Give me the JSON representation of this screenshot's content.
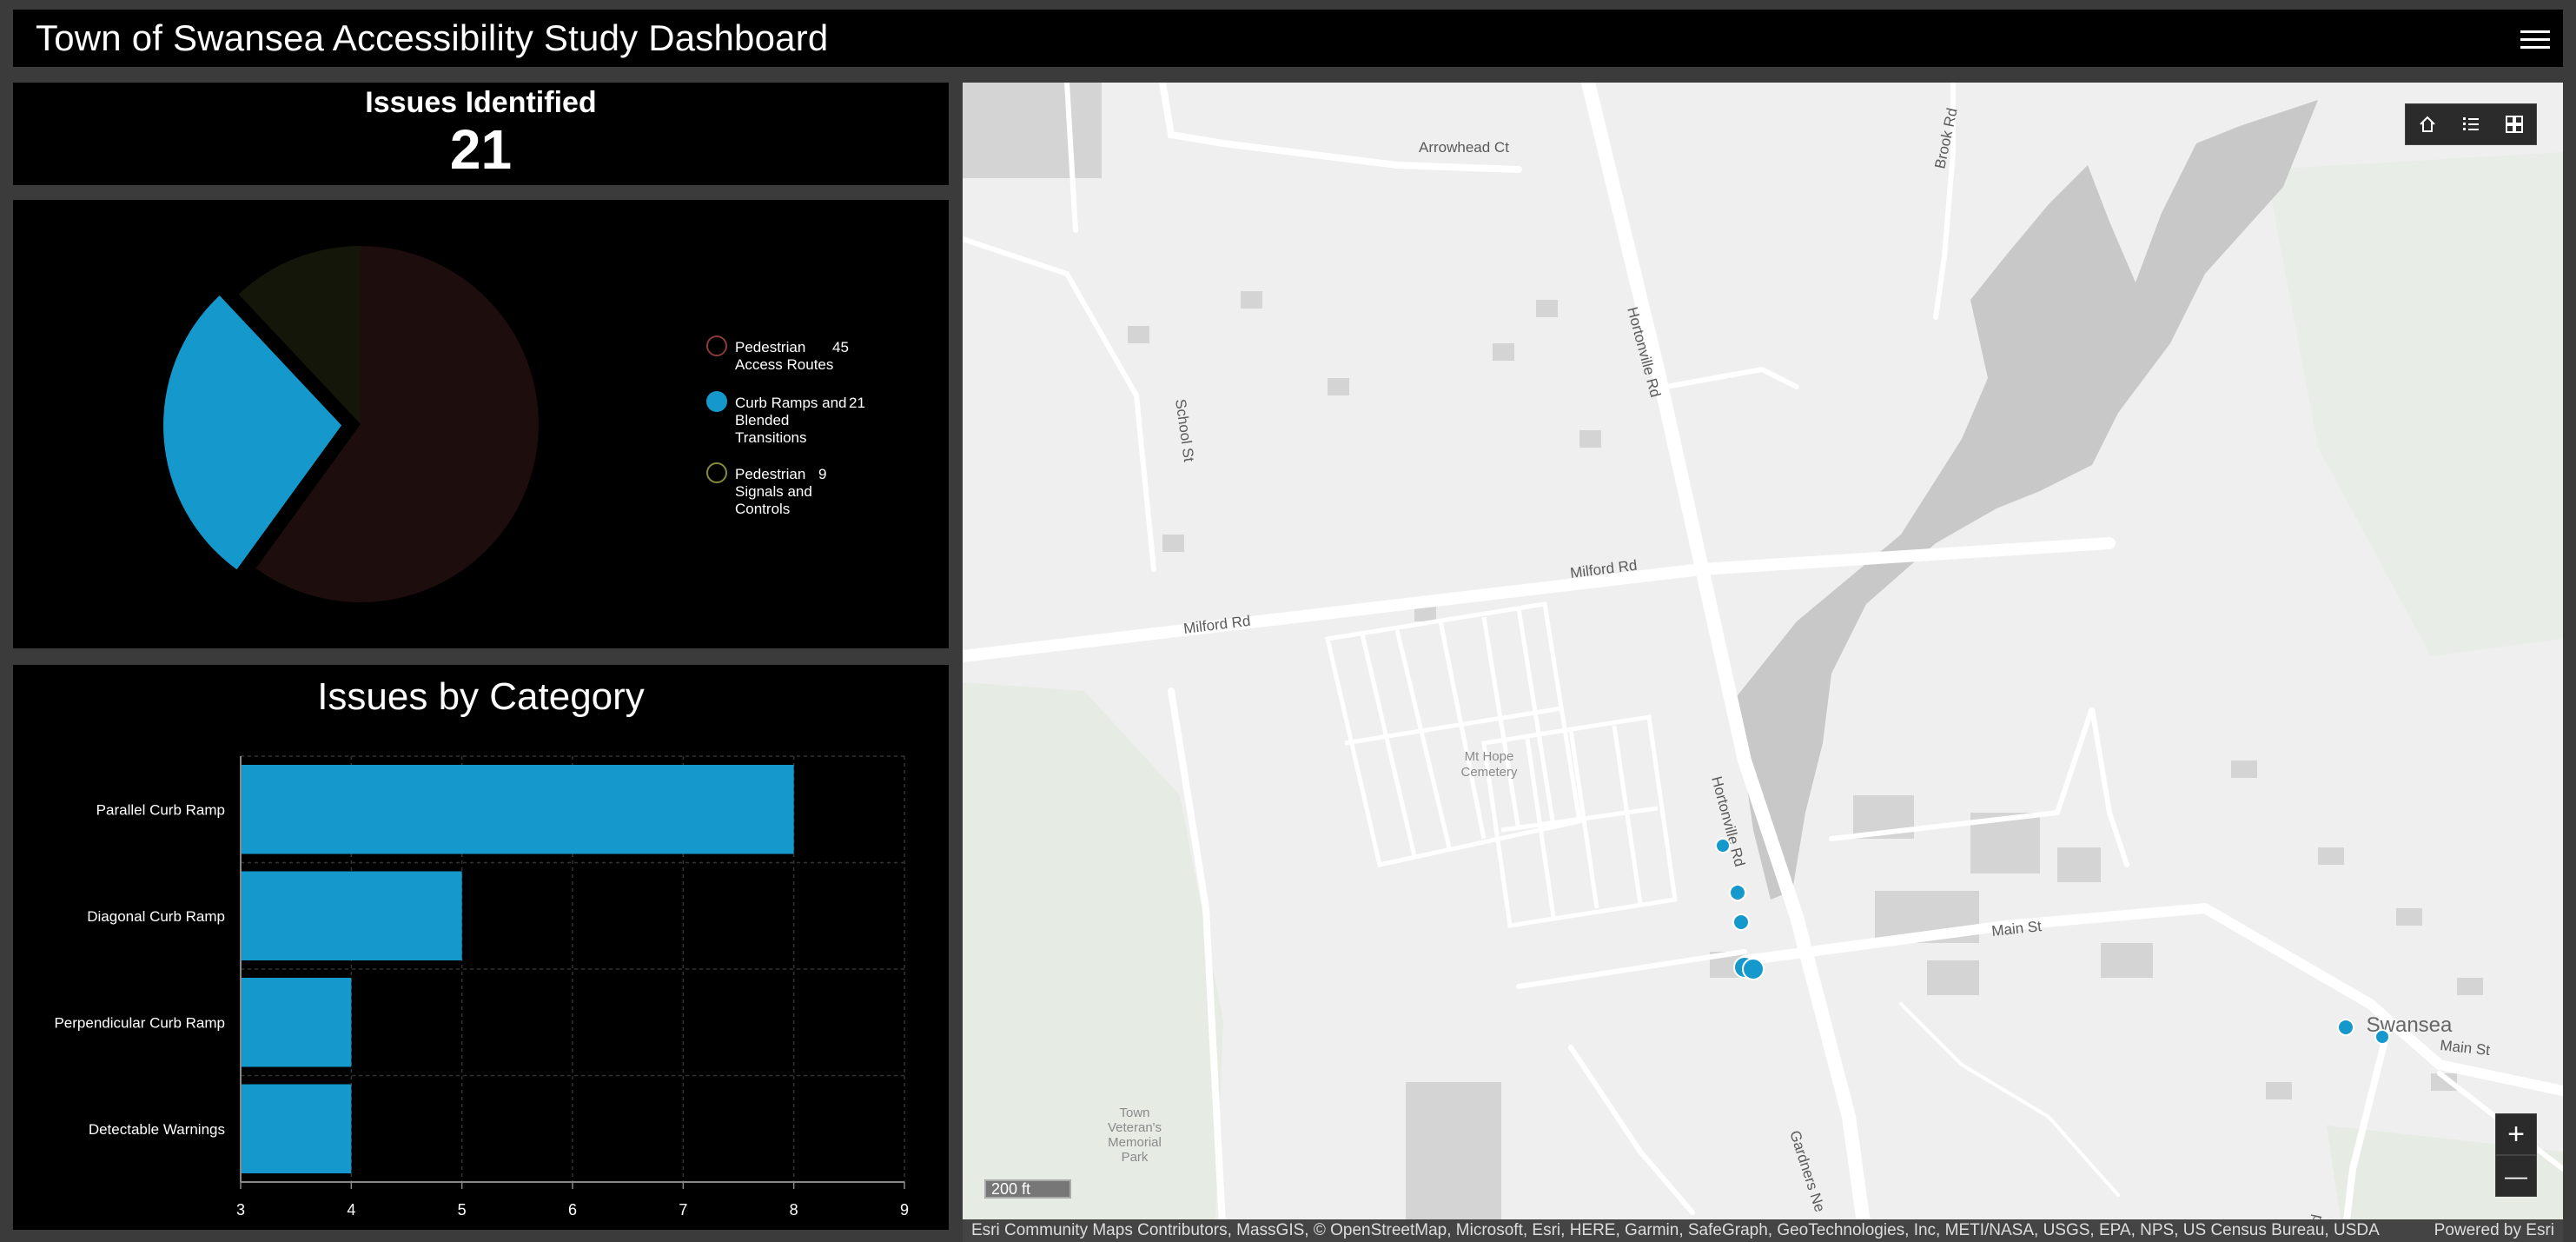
{
  "header": {
    "title": "Town of Swansea Accessibility Study Dashboard"
  },
  "indicator": {
    "title": "Issues Identified",
    "value": "21"
  },
  "pie": {
    "chart_data": {
      "type": "pie",
      "slices": [
        {
          "label": "Pedestrian Access Routes",
          "label_lines": [
            "Pedestrian",
            "Access Routes"
          ],
          "value": 45,
          "color": "#1e0d0d",
          "stroke": "#8a3a3a",
          "value_text": "45"
        },
        {
          "label": "Curb Ramps and Blended Transitions",
          "label_lines": [
            "Curb Ramps and",
            "Blended",
            "Transitions"
          ],
          "value": 21,
          "color": "#1599cc",
          "stroke": "#1599cc",
          "value_text": "21",
          "exploded": true
        },
        {
          "label": "Pedestrian Signals and Controls",
          "label_lines": [
            "Pedestrian",
            "Signals and",
            "Controls"
          ],
          "value": 9,
          "color": "#141609",
          "stroke": "#8a8a3a",
          "value_text": "9"
        }
      ]
    }
  },
  "bars": {
    "title": "Issues by Category",
    "chart_data": {
      "type": "bar",
      "orientation": "horizontal",
      "categories": [
        "Parallel Curb Ramp",
        "Diagonal Curb Ramp",
        "Perpendicular Curb Ramp",
        "Detectable Warnings"
      ],
      "values": [
        8,
        5,
        4,
        4
      ],
      "xlim": [
        3,
        9
      ],
      "ticks": [
        "3",
        "4",
        "5",
        "6",
        "7",
        "8",
        "9"
      ],
      "color": "#1599cc",
      "grid": true
    }
  },
  "map": {
    "roads": {
      "arrowhead": "Arrowhead Ct",
      "brook": "Brook Rd",
      "school": "School St",
      "hortonville": "Hortonville Rd",
      "milford_left": "Milford Rd",
      "milford_right": "Milford Rd",
      "hortonville2": "Hortonville Rd",
      "main1": "Main St",
      "main2": "Main St",
      "gardners": "Gardners Ne",
      "rd": "Rd"
    },
    "places": {
      "cemetery_line1": "Mt Hope",
      "cemetery_line2": "Cemetery",
      "park_line1": "Town",
      "park_line2": "Veteran's",
      "park_line3": "Memorial",
      "park_line4": "Park",
      "town": "Swansea"
    },
    "scale": "200 ft",
    "attribution": "Esri Community Maps Contributors, MassGIS, © OpenStreetMap, Microsoft, Esri, HERE, Garmin, SafeGraph, GeoTechnologies, Inc, METI/NASA, USGS, EPA, NPS, US Census Bureau, USDA",
    "powered_by": "Powered by Esri",
    "buttons": {
      "search_icon": "search-icon",
      "home_icon": "home-icon",
      "legend_icon": "legend-list-icon",
      "basemap_icon": "basemap-gallery-icon",
      "zoom_in": "+",
      "zoom_out": "—"
    }
  }
}
